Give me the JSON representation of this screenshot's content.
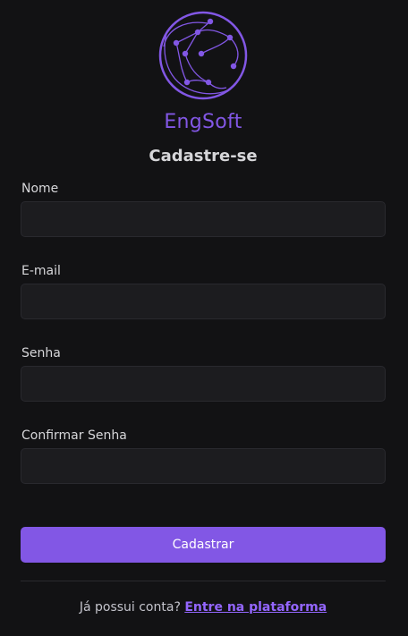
{
  "brand": {
    "name": "EngSoft",
    "logo_icon": "network-globe-icon",
    "accent_color": "#8257e5"
  },
  "page": {
    "title": "Cadastre-se"
  },
  "form": {
    "fields": [
      {
        "label": "Nome",
        "value": "",
        "placeholder": ""
      },
      {
        "label": "E-mail",
        "value": "",
        "placeholder": ""
      },
      {
        "label": "Senha",
        "value": "",
        "placeholder": ""
      },
      {
        "label": "Confirmar Senha",
        "value": "",
        "placeholder": ""
      }
    ],
    "submit_label": "Cadastrar"
  },
  "footer": {
    "prompt": "Já possui conta?",
    "link_label": "Entre na plataforma"
  }
}
